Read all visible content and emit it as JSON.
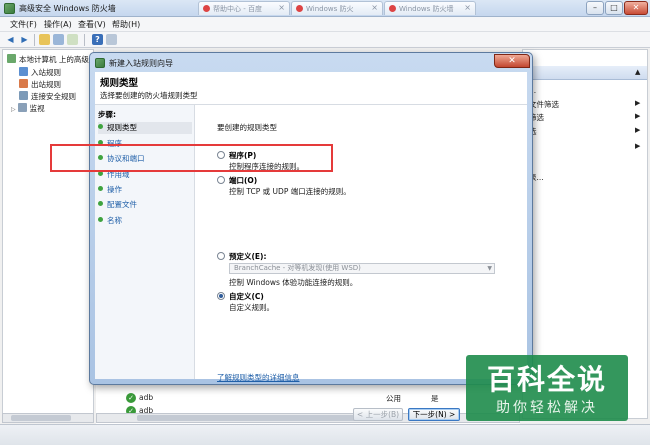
{
  "parent_window": {
    "title": "高级安全 Windows 防火墙",
    "menu": [
      "文件(F)",
      "操作(A)",
      "查看(V)",
      "帮助(H)"
    ],
    "bg_tabs": [
      "帮助中心 - 百度",
      "Windows 防火",
      "Windows 防火墙"
    ]
  },
  "nav_tree": {
    "root": "本地计算机 上的高级",
    "items": [
      "入站规则",
      "出站规则",
      "连接安全规则",
      "监视"
    ]
  },
  "actions_pane": {
    "items": [
      "...",
      "文件筛选",
      "筛选",
      "选",
      "",
      "表..."
    ]
  },
  "rule_list": {
    "rows": [
      {
        "name": "adb",
        "profile": "公用",
        "enabled": "是"
      },
      {
        "name": "adb",
        "profile": "公用",
        "enabled": "是"
      }
    ]
  },
  "wizard": {
    "title": "新建入站规则向导",
    "heading": "规则类型",
    "subheading": "选择要创建的防火墙规则类型",
    "steps_label": "步骤:",
    "steps": [
      "规则类型",
      "程序",
      "协议和端口",
      "作用域",
      "操作",
      "配置文件",
      "名称"
    ],
    "prompt": "要创建的规则类型",
    "options": [
      {
        "label": "程序(P)",
        "desc": "控制程序连接的规则。",
        "checked": false
      },
      {
        "label": "端口(O)",
        "desc": "控制 TCP 或 UDP 端口连接的规则。",
        "checked": false
      },
      {
        "label": "预定义(E):",
        "desc": "控制 Windows 体验功能连接的规则。",
        "checked": false
      },
      {
        "label": "自定义(C)",
        "desc": "自定义规则。",
        "checked": true
      }
    ],
    "predefined_value": "BranchCache - 对等机发现(使用 WSD)",
    "learn_more_link": "了解规则类型的详细信息",
    "back_button": "< 上一步(B)",
    "next_button": "下一步(N) >"
  },
  "watermark": {
    "title": "百科全说",
    "subtitle": "助你轻松解决"
  }
}
